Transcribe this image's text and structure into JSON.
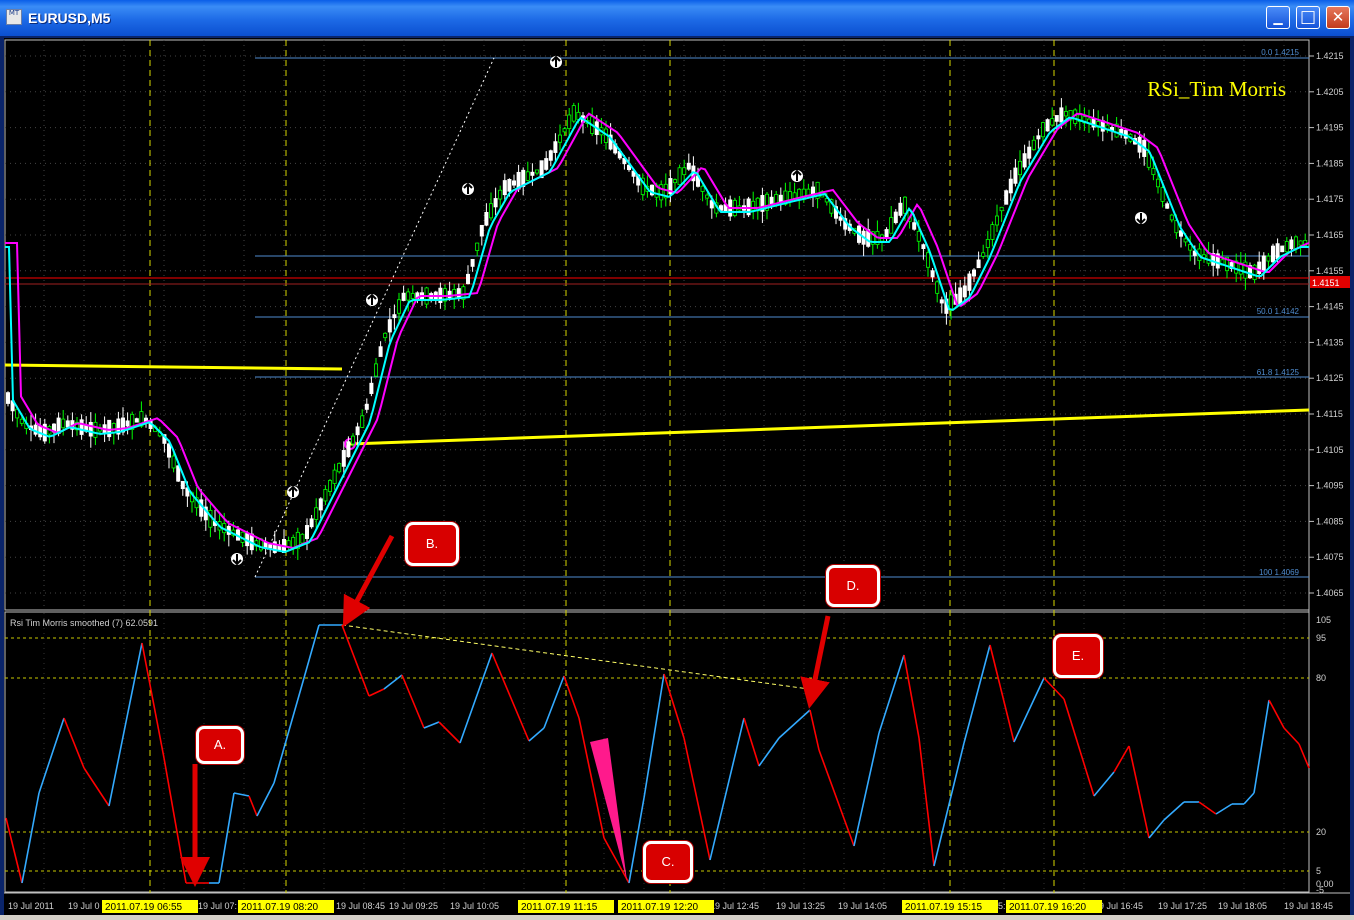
{
  "window": {
    "title": "EURUSD,M5",
    "app_icon_text": "MT",
    "min_glyph": "▁",
    "max_glyph": "□",
    "close_glyph": "✕"
  },
  "main_chart": {
    "overlay_title": "RSi_Tim Morris",
    "current_price": "1.4151",
    "price_axis": [
      "1.4215",
      "1.4205",
      "1.4195",
      "1.4185",
      "1.4175",
      "1.4165",
      "1.4155",
      "1.4145",
      "1.4135",
      "1.4125",
      "1.4115",
      "1.4105",
      "1.4095",
      "1.4085",
      "1.4075",
      "1.4065"
    ],
    "fib_levels": [
      {
        "label": "0.0  1.4215"
      },
      {
        "label": "50.0  1.4142"
      },
      {
        "label": "61.8  1.4125"
      },
      {
        "label": "100  1.4069"
      }
    ]
  },
  "indicator": {
    "title": "Rsi Tim Morris smoothed (7) 62.0591",
    "levels": [
      "105",
      "95",
      "80",
      "20",
      "5",
      "0.00",
      "-5"
    ]
  },
  "annotations": [
    "A.",
    "B.",
    "C.",
    "D.",
    "E."
  ],
  "time_axis": {
    "labels": [
      "19 Jul 2011",
      "19 Jul 0",
      "19 Jul 07:",
      "19 Jul 08:45",
      "19 Jul 09:25",
      "19 Jul 10:05",
      "19 Jul 12:45",
      "19 Jul 13:25",
      "19 Jul 14:05",
      "5:",
      "19 Jul 16:45",
      "19 Jul 17:25",
      "19 Jul 18:05",
      "19 Jul 18:45"
    ],
    "highlights": [
      "2011.07.19 06:55",
      "2011.07.19 08:20",
      "2011.07.19 11:15",
      "2011.07.19 12:20",
      "2011.07.19 15:15",
      "2011.07.19 16:20"
    ]
  },
  "colors": {
    "bull_candle": "#00ff00",
    "bear_candle": "#ffffff",
    "ma_fast": "#00ffff",
    "ma_slow": "#ff00ff",
    "rsi_up": "#33aaff",
    "rsi_down": "#ff0000",
    "fib": "#4f8ccf",
    "support": "#ffff00",
    "session": "#d8d800"
  }
}
